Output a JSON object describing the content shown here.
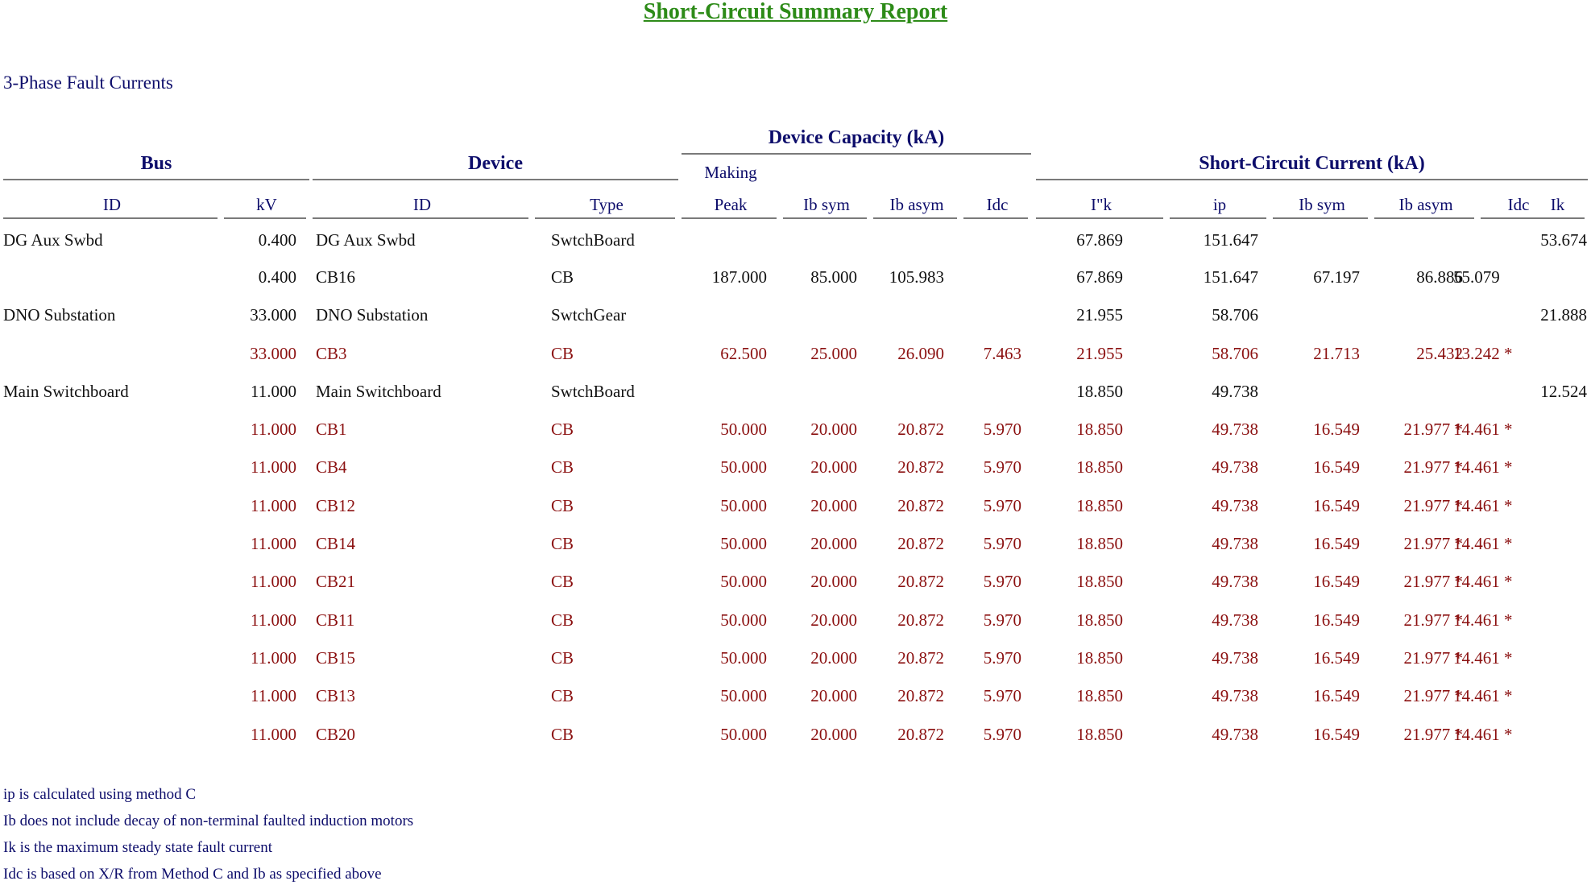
{
  "report": {
    "title": "Short-Circuit Summary Report",
    "section": "3-Phase Fault Currents"
  },
  "headers": {
    "bus": "Bus",
    "device": "Device",
    "device_capacity": "Device Capacity (kA)",
    "making": "Making",
    "short_circuit_current": "Short-Circuit Current (kA)",
    "columns": [
      "ID",
      "kV",
      "ID",
      "Type",
      "Peak",
      "Ib sym",
      "Ib asym",
      "Idc",
      "I\"k",
      "ip",
      "Ib sym",
      "Ib asym",
      "Idc",
      "Ik"
    ]
  },
  "rows": [
    {
      "bus_id": "DG Aux Swbd",
      "kv": "0.400",
      "dev_id": "DG Aux Swbd",
      "type": "SwtchBoard",
      "peak": "",
      "cap_ib_sym": "",
      "cap_ib_asym": "",
      "cap_idc": "",
      "ik2": "67.869",
      "ip": "151.647",
      "ib_sym": "",
      "ib_asym": "",
      "idc": "",
      "ik": "53.674",
      "tone": "black"
    },
    {
      "bus_id": "",
      "kv": "0.400",
      "dev_id": "CB16",
      "type": "CB",
      "peak": "187.000",
      "cap_ib_sym": "85.000",
      "cap_ib_asym": "105.983",
      "cap_idc": "",
      "ik2": "67.869",
      "ip": "151.647",
      "ib_sym": "67.197",
      "ib_asym": "86.886",
      "idc": "55.079",
      "ik": "",
      "tone": "black"
    },
    {
      "bus_id": "DNO Substation",
      "kv": "33.000",
      "dev_id": "DNO Substation",
      "type": "SwtchGear",
      "peak": "",
      "cap_ib_sym": "",
      "cap_ib_asym": "",
      "cap_idc": "",
      "ik2": "21.955",
      "ip": "58.706",
      "ib_sym": "",
      "ib_asym": "",
      "idc": "",
      "ik": "21.888",
      "tone": "black"
    },
    {
      "bus_id": "",
      "kv": "33.000",
      "dev_id": "CB3",
      "type": "CB",
      "peak": "62.500",
      "cap_ib_sym": "25.000",
      "cap_ib_asym": "26.090",
      "cap_idc": "7.463",
      "ik2": "21.955",
      "ip": "58.706",
      "ib_sym": "21.713",
      "ib_asym": "25.432",
      "idc": "13.242 *",
      "ik": "",
      "tone": "red"
    },
    {
      "bus_id": "Main Switchboard",
      "kv": "11.000",
      "dev_id": "Main Switchboard",
      "type": "SwtchBoard",
      "peak": "",
      "cap_ib_sym": "",
      "cap_ib_asym": "",
      "cap_idc": "",
      "ik2": "18.850",
      "ip": "49.738",
      "ib_sym": "",
      "ib_asym": "",
      "idc": "",
      "ik": "12.524",
      "tone": "black"
    },
    {
      "bus_id": "",
      "kv": "11.000",
      "dev_id": "CB1",
      "type": "CB",
      "peak": "50.000",
      "cap_ib_sym": "20.000",
      "cap_ib_asym": "20.872",
      "cap_idc": "5.970",
      "ik2": "18.850",
      "ip": "49.738",
      "ib_sym": "16.549",
      "ib_asym": "21.977 *",
      "idc": "14.461 *",
      "ik": "",
      "tone": "red"
    },
    {
      "bus_id": "",
      "kv": "11.000",
      "dev_id": "CB4",
      "type": "CB",
      "peak": "50.000",
      "cap_ib_sym": "20.000",
      "cap_ib_asym": "20.872",
      "cap_idc": "5.970",
      "ik2": "18.850",
      "ip": "49.738",
      "ib_sym": "16.549",
      "ib_asym": "21.977 *",
      "idc": "14.461 *",
      "ik": "",
      "tone": "red"
    },
    {
      "bus_id": "",
      "kv": "11.000",
      "dev_id": "CB12",
      "type": "CB",
      "peak": "50.000",
      "cap_ib_sym": "20.000",
      "cap_ib_asym": "20.872",
      "cap_idc": "5.970",
      "ik2": "18.850",
      "ip": "49.738",
      "ib_sym": "16.549",
      "ib_asym": "21.977 *",
      "idc": "14.461 *",
      "ik": "",
      "tone": "red"
    },
    {
      "bus_id": "",
      "kv": "11.000",
      "dev_id": "CB14",
      "type": "CB",
      "peak": "50.000",
      "cap_ib_sym": "20.000",
      "cap_ib_asym": "20.872",
      "cap_idc": "5.970",
      "ik2": "18.850",
      "ip": "49.738",
      "ib_sym": "16.549",
      "ib_asym": "21.977 *",
      "idc": "14.461 *",
      "ik": "",
      "tone": "red"
    },
    {
      "bus_id": "",
      "kv": "11.000",
      "dev_id": "CB21",
      "type": "CB",
      "peak": "50.000",
      "cap_ib_sym": "20.000",
      "cap_ib_asym": "20.872",
      "cap_idc": "5.970",
      "ik2": "18.850",
      "ip": "49.738",
      "ib_sym": "16.549",
      "ib_asym": "21.977 *",
      "idc": "14.461 *",
      "ik": "",
      "tone": "red"
    },
    {
      "bus_id": "",
      "kv": "11.000",
      "dev_id": "CB11",
      "type": "CB",
      "peak": "50.000",
      "cap_ib_sym": "20.000",
      "cap_ib_asym": "20.872",
      "cap_idc": "5.970",
      "ik2": "18.850",
      "ip": "49.738",
      "ib_sym": "16.549",
      "ib_asym": "21.977 *",
      "idc": "14.461 *",
      "ik": "",
      "tone": "red"
    },
    {
      "bus_id": "",
      "kv": "11.000",
      "dev_id": "CB15",
      "type": "CB",
      "peak": "50.000",
      "cap_ib_sym": "20.000",
      "cap_ib_asym": "20.872",
      "cap_idc": "5.970",
      "ik2": "18.850",
      "ip": "49.738",
      "ib_sym": "16.549",
      "ib_asym": "21.977 *",
      "idc": "14.461 *",
      "ik": "",
      "tone": "red"
    },
    {
      "bus_id": "",
      "kv": "11.000",
      "dev_id": "CB13",
      "type": "CB",
      "peak": "50.000",
      "cap_ib_sym": "20.000",
      "cap_ib_asym": "20.872",
      "cap_idc": "5.970",
      "ik2": "18.850",
      "ip": "49.738",
      "ib_sym": "16.549",
      "ib_asym": "21.977 *",
      "idc": "14.461 *",
      "ik": "",
      "tone": "red"
    },
    {
      "bus_id": "",
      "kv": "11.000",
      "dev_id": "CB20",
      "type": "CB",
      "peak": "50.000",
      "cap_ib_sym": "20.000",
      "cap_ib_asym": "20.872",
      "cap_idc": "5.970",
      "ik2": "18.850",
      "ip": "49.738",
      "ib_sym": "16.549",
      "ib_asym": "21.977 *",
      "idc": "14.461 *",
      "ik": "",
      "tone": "red"
    }
  ],
  "notes": [
    "ip is calculated using method C",
    "Ib does not include decay of non-terminal faulted induction motors",
    "Ik is the maximum steady state fault current",
    "Idc is based on X/R from Method C and Ib as specified above"
  ],
  "colors": {
    "title": "#2d8b18",
    "header_text": "#0d0d6b",
    "row_normal": "#111111",
    "row_flagged": "#8b1010",
    "rule": "#7a7a7a"
  }
}
